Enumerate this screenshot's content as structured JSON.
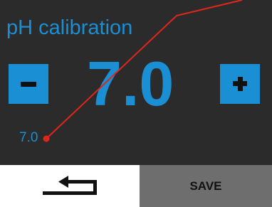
{
  "screen": {
    "title": "pH calibration",
    "value": "7.0",
    "reading": "7.0"
  },
  "controls": {
    "decrease_icon": "minus-icon",
    "increase_icon": "plus-icon"
  },
  "footer": {
    "back_icon": "return-arrow-icon",
    "save_label": "SAVE"
  },
  "colors": {
    "background": "#2b2b2b",
    "accent": "#1a8fd4",
    "pointer_line": "#e0261b",
    "save_button": "#6e6e6e",
    "back_button": "#ffffff"
  }
}
